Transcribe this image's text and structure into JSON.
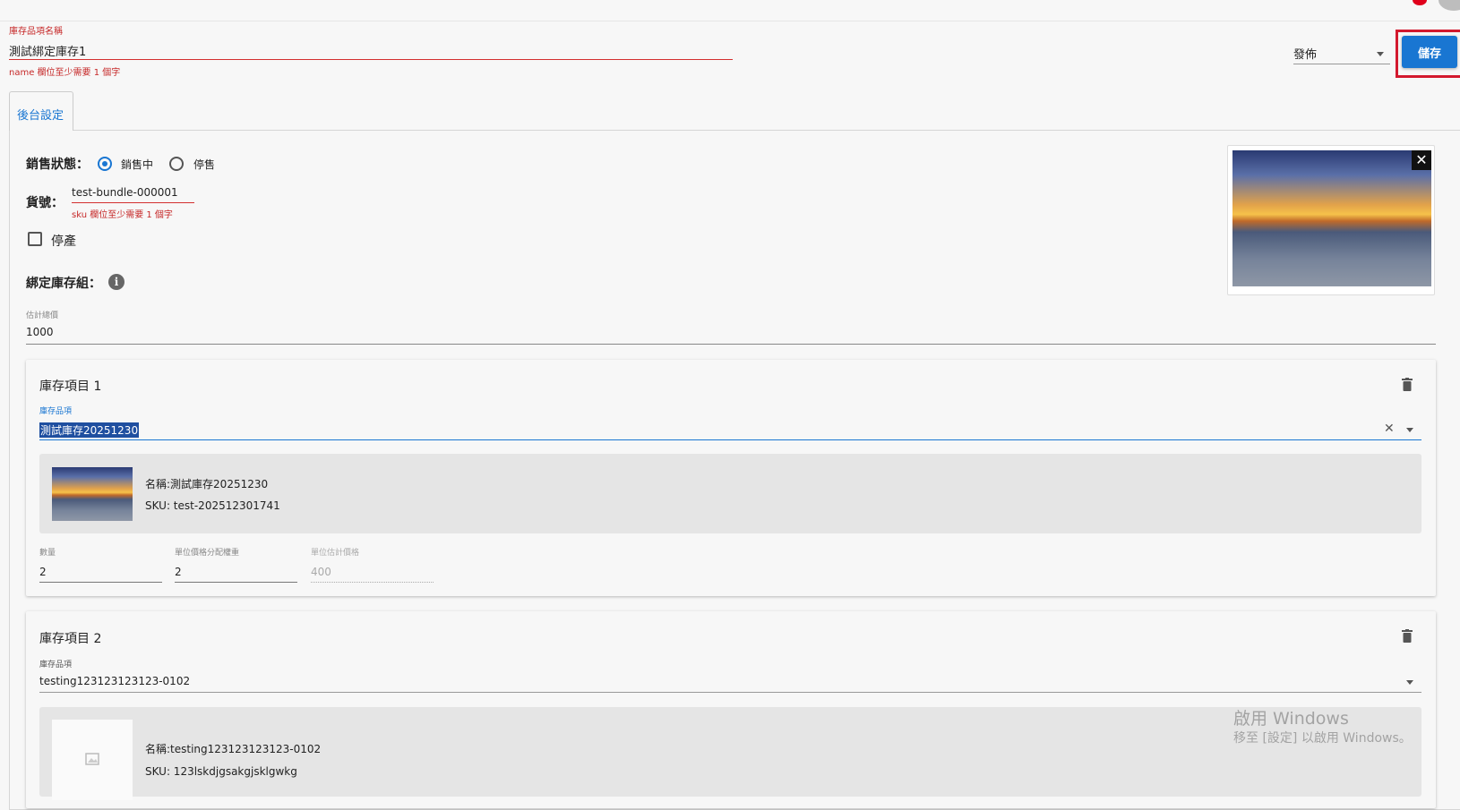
{
  "header": {
    "name_label": "庫存品項名稱",
    "name_value": "測試綁定庫存1",
    "name_error": "name 欄位至少需要 1 個字",
    "publish_value": "發佈",
    "save_label": "儲存"
  },
  "tabs": [
    {
      "label": "後台設定"
    }
  ],
  "settings": {
    "sale_status_label": "銷售狀態：",
    "sale_status_options": [
      "銷售中",
      "停售"
    ],
    "sale_status_selected": "銷售中",
    "sku_label": "貨號：",
    "sku_value": "test-bundle-000001",
    "sku_error": "sku 欄位至少需要 1 個字",
    "discontinued_label": "停產",
    "discontinued_checked": false,
    "bundle_label": "綁定庫存組：",
    "total_label": "估計總價",
    "total_value": "1000"
  },
  "items": [
    {
      "title": "庫存項目 1",
      "product_label": "庫存品項",
      "product_value": "測試庫存20251230",
      "detail_name": "名稱:測試庫存20251230",
      "detail_sku": "SKU: test-202512301741",
      "qty_label": "數量",
      "qty_value": "2",
      "weight_label": "單位價格分配權重",
      "weight_value": "2",
      "unit_price_label": "單位估計價格",
      "unit_price_value": "400"
    },
    {
      "title": "庫存項目 2",
      "product_label": "庫存品項",
      "product_value": "testing123123123123-0102",
      "detail_name": "名稱:testing123123123123-0102",
      "detail_sku": "SKU: 123lskdjgsakgjsklgwkg"
    }
  ],
  "watermark": {
    "line1": "啟用 Windows",
    "line2": "移至 [設定] 以啟用 Windows。"
  },
  "colors": {
    "accent": "#1976d2",
    "error": "#d32f2f",
    "highlight": "#d3192e"
  }
}
